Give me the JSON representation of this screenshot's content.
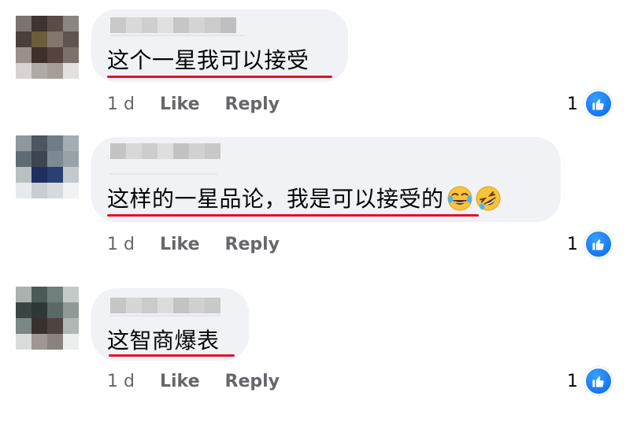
{
  "comments": [
    {
      "text": "这个一星我可以接受",
      "time": "1 d",
      "like_label": "Like",
      "reply_label": "Reply",
      "reaction_count": "1",
      "emojis": []
    },
    {
      "text": "这样的一星品论，我是可以接受的",
      "time": "1 d",
      "like_label": "Like",
      "reply_label": "Reply",
      "reaction_count": "1",
      "emojis": [
        "tears-of-joy-emoji",
        "rolling-laughing-emoji"
      ]
    },
    {
      "text": "这智商爆表",
      "time": "1 d",
      "like_label": "Like",
      "reply_label": "Reply",
      "reaction_count": "1",
      "emojis": []
    }
  ],
  "colors": {
    "bubble": "#f0f2f5",
    "underline": "#e0112b",
    "meta_text": "#65676b",
    "like_blue": "#1877f2"
  },
  "icons": {
    "reaction": "thumbs-up-icon"
  }
}
